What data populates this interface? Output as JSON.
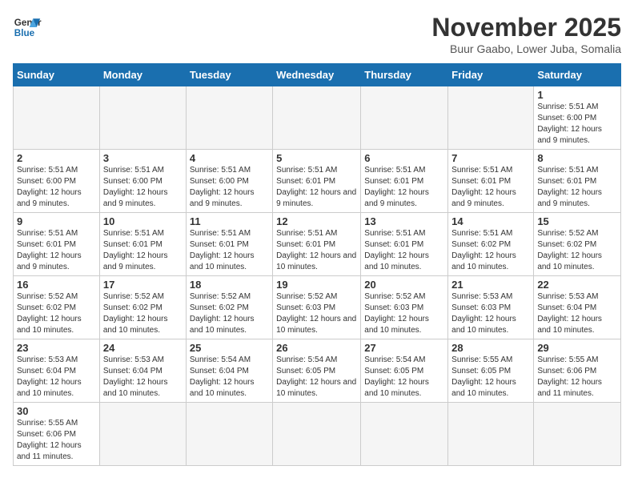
{
  "header": {
    "logo_general": "General",
    "logo_blue": "Blue",
    "month_title": "November 2025",
    "location": "Buur Gaabo, Lower Juba, Somalia"
  },
  "weekdays": [
    "Sunday",
    "Monday",
    "Tuesday",
    "Wednesday",
    "Thursday",
    "Friday",
    "Saturday"
  ],
  "days": [
    {
      "num": "",
      "info": ""
    },
    {
      "num": "",
      "info": ""
    },
    {
      "num": "",
      "info": ""
    },
    {
      "num": "",
      "info": ""
    },
    {
      "num": "",
      "info": ""
    },
    {
      "num": "",
      "info": ""
    },
    {
      "num": "1",
      "info": "Sunrise: 5:51 AM\nSunset: 6:00 PM\nDaylight: 12 hours and 9 minutes."
    },
    {
      "num": "2",
      "info": "Sunrise: 5:51 AM\nSunset: 6:00 PM\nDaylight: 12 hours and 9 minutes."
    },
    {
      "num": "3",
      "info": "Sunrise: 5:51 AM\nSunset: 6:00 PM\nDaylight: 12 hours and 9 minutes."
    },
    {
      "num": "4",
      "info": "Sunrise: 5:51 AM\nSunset: 6:00 PM\nDaylight: 12 hours and 9 minutes."
    },
    {
      "num": "5",
      "info": "Sunrise: 5:51 AM\nSunset: 6:01 PM\nDaylight: 12 hours and 9 minutes."
    },
    {
      "num": "6",
      "info": "Sunrise: 5:51 AM\nSunset: 6:01 PM\nDaylight: 12 hours and 9 minutes."
    },
    {
      "num": "7",
      "info": "Sunrise: 5:51 AM\nSunset: 6:01 PM\nDaylight: 12 hours and 9 minutes."
    },
    {
      "num": "8",
      "info": "Sunrise: 5:51 AM\nSunset: 6:01 PM\nDaylight: 12 hours and 9 minutes."
    },
    {
      "num": "9",
      "info": "Sunrise: 5:51 AM\nSunset: 6:01 PM\nDaylight: 12 hours and 9 minutes."
    },
    {
      "num": "10",
      "info": "Sunrise: 5:51 AM\nSunset: 6:01 PM\nDaylight: 12 hours and 9 minutes."
    },
    {
      "num": "11",
      "info": "Sunrise: 5:51 AM\nSunset: 6:01 PM\nDaylight: 12 hours and 10 minutes."
    },
    {
      "num": "12",
      "info": "Sunrise: 5:51 AM\nSunset: 6:01 PM\nDaylight: 12 hours and 10 minutes."
    },
    {
      "num": "13",
      "info": "Sunrise: 5:51 AM\nSunset: 6:01 PM\nDaylight: 12 hours and 10 minutes."
    },
    {
      "num": "14",
      "info": "Sunrise: 5:51 AM\nSunset: 6:02 PM\nDaylight: 12 hours and 10 minutes."
    },
    {
      "num": "15",
      "info": "Sunrise: 5:52 AM\nSunset: 6:02 PM\nDaylight: 12 hours and 10 minutes."
    },
    {
      "num": "16",
      "info": "Sunrise: 5:52 AM\nSunset: 6:02 PM\nDaylight: 12 hours and 10 minutes."
    },
    {
      "num": "17",
      "info": "Sunrise: 5:52 AM\nSunset: 6:02 PM\nDaylight: 12 hours and 10 minutes."
    },
    {
      "num": "18",
      "info": "Sunrise: 5:52 AM\nSunset: 6:02 PM\nDaylight: 12 hours and 10 minutes."
    },
    {
      "num": "19",
      "info": "Sunrise: 5:52 AM\nSunset: 6:03 PM\nDaylight: 12 hours and 10 minutes."
    },
    {
      "num": "20",
      "info": "Sunrise: 5:52 AM\nSunset: 6:03 PM\nDaylight: 12 hours and 10 minutes."
    },
    {
      "num": "21",
      "info": "Sunrise: 5:53 AM\nSunset: 6:03 PM\nDaylight: 12 hours and 10 minutes."
    },
    {
      "num": "22",
      "info": "Sunrise: 5:53 AM\nSunset: 6:04 PM\nDaylight: 12 hours and 10 minutes."
    },
    {
      "num": "23",
      "info": "Sunrise: 5:53 AM\nSunset: 6:04 PM\nDaylight: 12 hours and 10 minutes."
    },
    {
      "num": "24",
      "info": "Sunrise: 5:53 AM\nSunset: 6:04 PM\nDaylight: 12 hours and 10 minutes."
    },
    {
      "num": "25",
      "info": "Sunrise: 5:54 AM\nSunset: 6:04 PM\nDaylight: 12 hours and 10 minutes."
    },
    {
      "num": "26",
      "info": "Sunrise: 5:54 AM\nSunset: 6:05 PM\nDaylight: 12 hours and 10 minutes."
    },
    {
      "num": "27",
      "info": "Sunrise: 5:54 AM\nSunset: 6:05 PM\nDaylight: 12 hours and 10 minutes."
    },
    {
      "num": "28",
      "info": "Sunrise: 5:55 AM\nSunset: 6:05 PM\nDaylight: 12 hours and 10 minutes."
    },
    {
      "num": "29",
      "info": "Sunrise: 5:55 AM\nSunset: 6:06 PM\nDaylight: 12 hours and 11 minutes."
    },
    {
      "num": "30",
      "info": "Sunrise: 5:55 AM\nSunset: 6:06 PM\nDaylight: 12 hours and 11 minutes."
    },
    {
      "num": "",
      "info": ""
    },
    {
      "num": "",
      "info": ""
    },
    {
      "num": "",
      "info": ""
    },
    {
      "num": "",
      "info": ""
    },
    {
      "num": "",
      "info": ""
    },
    {
      "num": "",
      "info": ""
    }
  ]
}
